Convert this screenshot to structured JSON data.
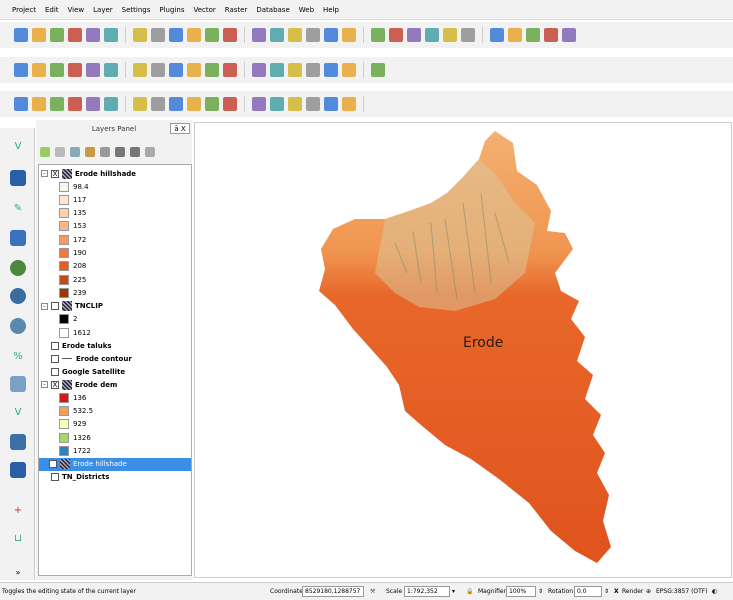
{
  "menu": [
    "Project",
    "Edit",
    "View",
    "Layer",
    "Settings",
    "Plugins",
    "Vector",
    "Raster",
    "Database",
    "Web",
    "Help"
  ],
  "toolbar_icons": {
    "row1": [
      "new-project-icon",
      "open-project-icon",
      "save-project-icon",
      "save-as-icon",
      "new-print-composer-icon",
      "composer-manager-icon",
      "pan-touch-icon",
      "pan-map-icon",
      "pan-to-selection-icon",
      "zoom-in-icon",
      "zoom-out-icon",
      "zoom-native-icon",
      "zoom-full-icon",
      "zoom-to-selection-icon",
      "zoom-to-layer-icon",
      "zoom-last-icon",
      "zoom-next-icon",
      "new-map-view-icon",
      "new-bookmark-icon",
      "refresh-icon",
      "identify-icon",
      "select-icon",
      "deselect-icon",
      "open-attribute-table-icon",
      "statistical-summary-icon",
      "measure-icon",
      "map-tips-icon",
      "text-annotation-icon",
      "help-icon"
    ],
    "row2": [
      "current-edits-icon",
      "toggle-editing-icon",
      "save-edits-icon",
      "digitize-icon",
      "move-feature-icon",
      "delete-selected-icon",
      "cut-features-icon",
      "copy-features-icon",
      "paste-features-icon",
      "label-icon",
      "pin-labels-icon",
      "layer-labeling-icon",
      "show-hide-labels-icon",
      "move-label-icon",
      "rotate-label-icon",
      "change-label-icon",
      "csw-icon",
      "python-icon",
      "checkmark-icon"
    ],
    "row3": [
      "node-tool-icon",
      "undo-icon",
      "redo-icon",
      "rotate-feature-icon",
      "simplify-icon",
      "add-ring-icon",
      "add-part-icon",
      "fill-ring-icon",
      "delete-ring-icon",
      "delete-part-icon",
      "reshape-icon",
      "offset-curve-icon",
      "split-features-icon",
      "split-parts-icon",
      "merge-features-icon",
      "merge-attributes-icon",
      "rotate-point-symbols-icon",
      "globe-icon"
    ]
  },
  "layers_panel": {
    "title": "Layers Panel",
    "controls": "ā X"
  },
  "layers": [
    {
      "name": "Erode hillshade",
      "checked": "X",
      "expanded": "-",
      "bold": true
    },
    {
      "legend": [
        {
          "label": "98.4",
          "color": "#fdf4ea"
        },
        {
          "label": "117",
          "color": "#fde7d4"
        },
        {
          "label": "135",
          "color": "#fcd1b0"
        },
        {
          "label": "153",
          "color": "#fbb78a"
        },
        {
          "label": "172",
          "color": "#f79a62"
        },
        {
          "label": "190",
          "color": "#ef7a3d"
        },
        {
          "label": "208",
          "color": "#df5e22"
        },
        {
          "label": "225",
          "color": "#c64a14"
        },
        {
          "label": "239",
          "color": "#9e3508"
        }
      ]
    },
    {
      "name": "TNCLIP",
      "checked": "",
      "expanded": "-",
      "bold": true
    },
    {
      "legend2": [
        {
          "label": "2",
          "color": "#000000"
        },
        {
          "label": "1612",
          "color": "#ffffff"
        }
      ]
    },
    {
      "name": "Erode taluks",
      "checked": "",
      "bold": true
    },
    {
      "name": "Erode contour",
      "checked": "",
      "bold": true
    },
    {
      "name": "Google Satellite",
      "checked": "",
      "bold": true
    },
    {
      "name": "Erode dem",
      "checked": "X",
      "expanded": "-",
      "bold": true
    },
    {
      "legend3": [
        {
          "label": "136",
          "color": "#d7191c"
        },
        {
          "label": "532.5",
          "color": "#f4a259"
        },
        {
          "label": "929",
          "color": "#ffffbf"
        },
        {
          "label": "1326",
          "color": "#a6d96a"
        },
        {
          "label": "1722",
          "color": "#2b83ba"
        }
      ]
    },
    {
      "name": "Erode hillshade",
      "checked": "X",
      "selected": true
    },
    {
      "name": "TN_Districts",
      "checked": "",
      "bold": true
    }
  ],
  "map": {
    "label": "Erode"
  },
  "statusbar": {
    "message": "Toggles the editing state of the current layer",
    "coordinate_label": "Coordinate",
    "coordinate_value": "8529180,1288757",
    "scale_label": "Scale",
    "scale_value": "1:792,352",
    "magnifier_label": "Magnifier",
    "magnifier_value": "100%",
    "rotation_label": "Rotation",
    "rotation_value": "0.0",
    "render_checked": "X",
    "render_label": "Render",
    "crs": "EPSG:3857 (OTF)"
  }
}
